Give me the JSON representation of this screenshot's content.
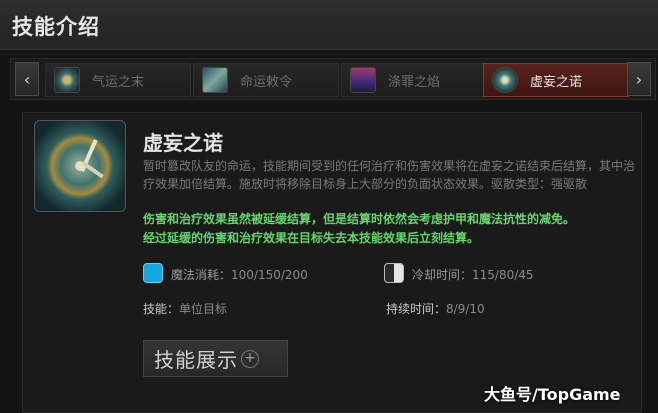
{
  "header": {
    "title": "技能介绍"
  },
  "tabs": [
    {
      "label": "气运之末",
      "icon": "fate-end-icon",
      "active": false
    },
    {
      "label": "命运敕令",
      "icon": "fate-edict-icon",
      "active": false
    },
    {
      "label": "涤罪之焰",
      "icon": "purifying-flames-icon",
      "active": false
    },
    {
      "label": "虚妄之诺",
      "icon": "false-promise-icon",
      "active": true
    }
  ],
  "skill": {
    "name": "虚妄之诺",
    "description": "暂时篡改队友的命运，技能期间受到的任何治疗和伤害效果将在虚妄之诺结束后结算，其中治疗效果加倍结算。施放时将移除目标身上大部分的负面状态效果。驱散类型：强驱散",
    "notes": [
      "伤害和治疗效果虽然被延缓结算，但是结算时依然会考虑护甲和魔法抗性的减免。",
      "经过延缓的伤害和治疗效果在目标失去本技能效果后立刻结算。"
    ],
    "mana_label": "魔法消耗：",
    "mana_value": "100/150/200",
    "cooldown_label": "冷却时间：",
    "cooldown_value": "115/80/45",
    "target_label": "技能：",
    "target_value": "单位目标",
    "duration_label": "持续时间：",
    "duration_value": "8/9/10"
  },
  "demo_button": {
    "label": "技能展示"
  },
  "watermark": "大鱼号/TopGame",
  "colors": {
    "accent_tab": "#5a221c",
    "notes_green": "#62d86a",
    "mana_blue": "#17a6e0"
  }
}
